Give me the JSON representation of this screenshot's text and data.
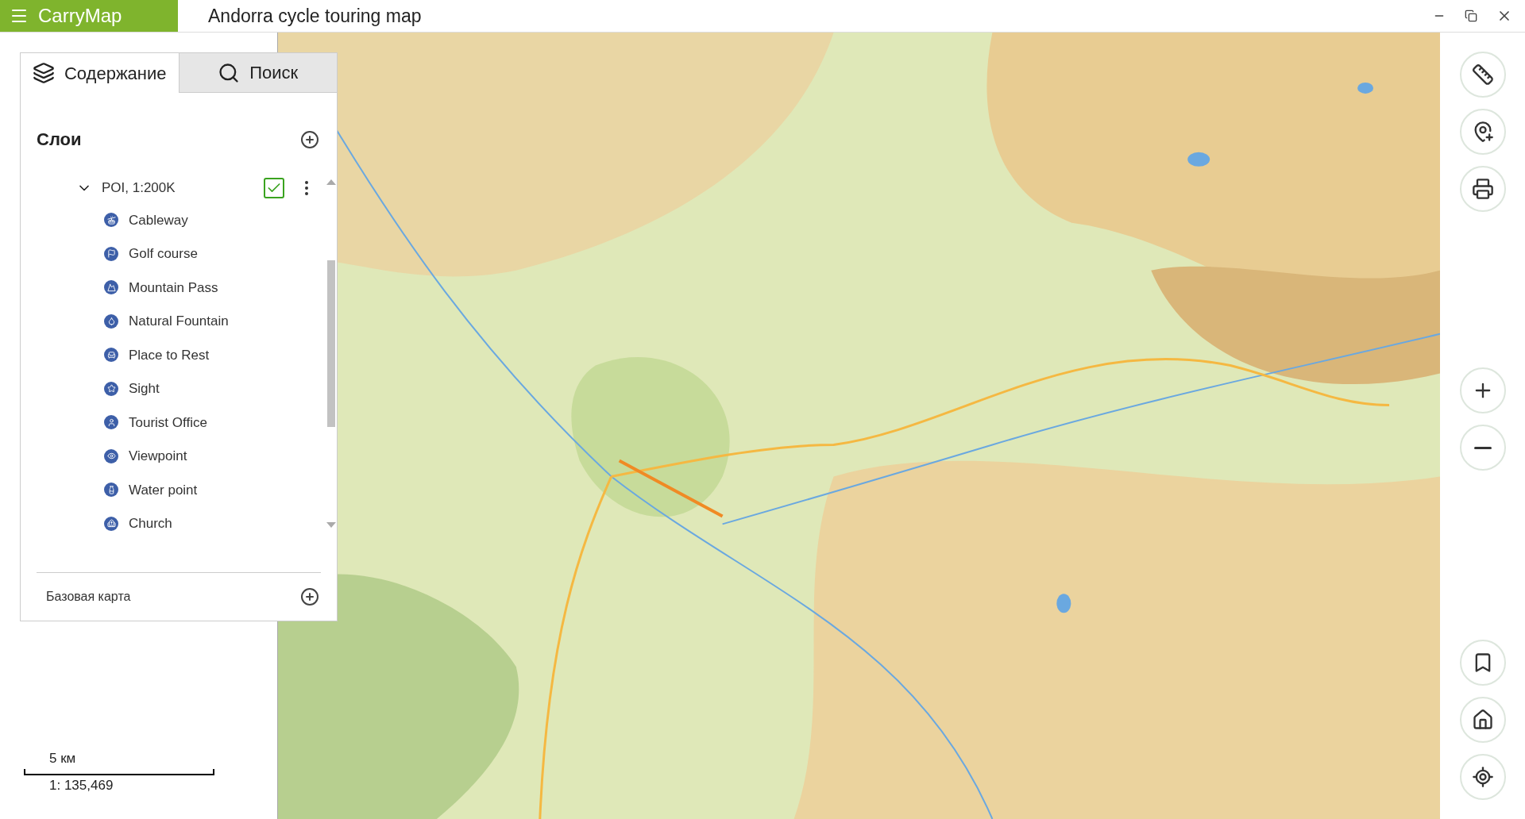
{
  "app": {
    "name": "CarryMap"
  },
  "window": {
    "title": "Andorra cycle touring map"
  },
  "panel": {
    "tabs": [
      {
        "label": "Содержание",
        "selected": true
      },
      {
        "label": "Поиск",
        "selected": false
      }
    ],
    "layers_heading": "Слои",
    "layer_group": {
      "name": "POI, 1:200K",
      "expanded": true,
      "checked": true,
      "items": [
        {
          "label": "Cableway"
        },
        {
          "label": "Golf course"
        },
        {
          "label": "Mountain Pass"
        },
        {
          "label": "Natural Fountain"
        },
        {
          "label": "Place to Rest"
        },
        {
          "label": "Sight"
        },
        {
          "label": "Tourist Office"
        },
        {
          "label": "Viewpoint"
        },
        {
          "label": "Water point"
        },
        {
          "label": "Church"
        }
      ]
    },
    "basemap_label": "Базовая карта"
  },
  "scale": {
    "distance": "5 км",
    "ratio": "1: 135,469"
  }
}
